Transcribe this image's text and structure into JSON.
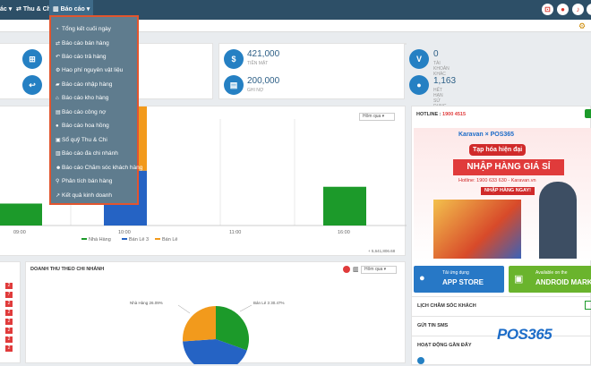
{
  "nav": {
    "items": [
      {
        "label": "ác ▾"
      },
      {
        "label": "Thu & Chi"
      },
      {
        "label": "Báo cáo ▾"
      }
    ],
    "right_icons": [
      "cart-icon",
      "map-pin-icon",
      "bell-icon",
      "user-icon"
    ]
  },
  "dropdown": {
    "items": [
      {
        "label": "Tổng kết cuối ngày",
        "icon": "clock-icon"
      },
      {
        "label": "Báo cáo bán hàng",
        "icon": "exchange-icon"
      },
      {
        "label": "Báo cáo trả hàng",
        "icon": "undo-icon"
      },
      {
        "label": "Hao phí nguyên vật liệu",
        "icon": "cogs-icon"
      },
      {
        "label": "Báo cáo nhập hàng",
        "icon": "truck-icon"
      },
      {
        "label": "Báo cáo kho hàng",
        "icon": "home-icon"
      },
      {
        "label": "Báo cáo công nợ",
        "icon": "book-icon"
      },
      {
        "label": "Báo cáo hoa hồng",
        "icon": "circle-icon"
      },
      {
        "label": "Sổ quỹ Thu & Chi",
        "icon": "wallet-icon"
      },
      {
        "label": "Báo cáo đa chi nhánh",
        "icon": "building-icon"
      },
      {
        "label": "Báo cáo Chăm sóc khách hàng",
        "icon": "users-icon"
      },
      {
        "label": "Phân tích bán hàng",
        "icon": "search-icon"
      },
      {
        "label": "Kết quả kinh doanh",
        "icon": "chart-icon"
      }
    ]
  },
  "stats": [
    {
      "value": "421,000",
      "label": "TIỀN MẶT",
      "icon": "money-icon"
    },
    {
      "value": "0",
      "label": "TÀI KHOẢN KHÁC",
      "icon": "visa-icon"
    },
    {
      "value": "200,000",
      "label": "GHI NỢ",
      "icon": "card-icon"
    },
    {
      "value": "1,163",
      "label": "HẾT HẠN SỬ DỤNG",
      "icon": "bomb-icon"
    }
  ],
  "chart_filter": "Hôm qua",
  "chart_data": [
    {
      "type": "bar",
      "categories": [
        "09:00",
        "10:00",
        "11:00",
        "16:00"
      ],
      "series": [
        {
          "name": "Nhà Hàng",
          "color": "#1c9a2a",
          "values": [
            680000,
            0,
            0,
            1200000
          ]
        },
        {
          "name": "Bán Lẻ 3",
          "color": "#2563c4",
          "values": [
            0,
            1700000,
            0,
            0
          ]
        },
        {
          "name": "Bán Lẻ",
          "color": "#f29a1c",
          "values": [
            0,
            3200000,
            0,
            0
          ]
        }
      ],
      "total_label": "+ 5,641,806.68"
    },
    {
      "type": "pie",
      "title": "DOANH THU THEO CHI NHÁNH",
      "slices": [
        {
          "label": "Nhà Hàng 26.09%",
          "value": 26.09,
          "color": "#f29a1c"
        },
        {
          "label": "Bán Lẻ 3 30.47%",
          "value": 30.47,
          "color": "#1c9a2a"
        },
        {
          "label": "",
          "value": 43.44,
          "color": "#2563c4"
        }
      ]
    }
  ],
  "pie_filter": "Hôm qua",
  "right": {
    "hotline_label": "HOTLINE :",
    "hotline_number": "1900 4515",
    "promo": {
      "brands": "Karavan × POS365",
      "line1": "Tạp hóa hiện đại",
      "line2": "NHẬP HÀNG GIÁ SỈ",
      "line3": "Hotline: 1900 633 630 - Karavan.vn",
      "cta": "NHẬP HÀNG NGAY!"
    },
    "appstore_small": "Tải ứng dụng",
    "appstore_big": "APP STORE",
    "android_small": "Available on the",
    "android_big": "ANDROID MARKET",
    "items": [
      "LỊCH CHĂM SÓC KHÁCH",
      "GỬI TIN SMS",
      "HOẠT ĐỘNG GẦN ĐÂY"
    ]
  },
  "left_badges": [
    "2",
    "7",
    "2",
    "2",
    "2",
    "2",
    "2",
    "2"
  ],
  "watermark": "POS365"
}
